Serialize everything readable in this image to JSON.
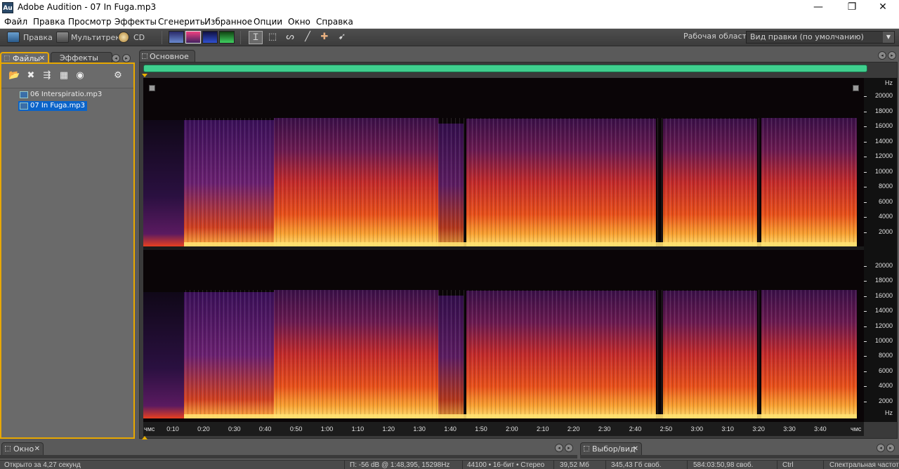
{
  "window": {
    "icon_text": "Au",
    "title": "Adobe Audition - 07 In Fuga.mp3",
    "minimize": "—",
    "maximize": "❐",
    "close": "✕"
  },
  "menu": [
    "Файл",
    "Правка",
    "Просмотр",
    "Эффекты",
    "Сгенерить",
    "Избранное",
    "Опции",
    "Окно",
    "Справка"
  ],
  "toolbar": {
    "edit_label": "Правка",
    "multitrack_label": "Мультитрек",
    "cd_label": "CD",
    "workspace_label": "Рабочая область:",
    "workspace_value": "Вид правки (по умолчанию)",
    "tools": [
      "time-selection-tool",
      "marquee-tool",
      "lasso-tool",
      "brush-tool",
      "spot-healing-tool",
      "scrub-tool"
    ],
    "tool_glyphs": [
      "Ｉ",
      "⬚",
      "ᔕ",
      "╱",
      "✚",
      "➹"
    ]
  },
  "left_panel": {
    "tabs": [
      {
        "label": "Файлы",
        "active": true,
        "close": "✕"
      },
      {
        "label": "Эффекты",
        "active": false
      }
    ],
    "files": [
      {
        "name": "06 Interspiratio.mp3",
        "selected": false
      },
      {
        "name": "07 In Fuga.mp3",
        "selected": true
      }
    ]
  },
  "main_panel": {
    "tab_label": "Основное",
    "hz_label": "Hz",
    "time_unit": "чмс",
    "freq_ticks_top": [
      "20000",
      "18000",
      "16000",
      "14000",
      "12000",
      "10000",
      "8000",
      "6000",
      "4000",
      "2000"
    ],
    "freq_ticks_bottom": [
      "20000",
      "18000",
      "16000",
      "14000",
      "12000",
      "10000",
      "8000",
      "6000",
      "4000",
      "2000"
    ],
    "time_ticks": [
      "0:10",
      "0:20",
      "0:30",
      "0:40",
      "0:50",
      "1:00",
      "1:10",
      "1:20",
      "1:30",
      "1:40",
      "1:50",
      "2:00",
      "2:10",
      "2:20",
      "2:30",
      "2:40",
      "2:50",
      "3:00",
      "3:10",
      "3:20",
      "3:30",
      "3:40"
    ]
  },
  "bottom_panels": {
    "window_tab": "Окно",
    "selection_tab": "Выбор/вид",
    "close": "✕"
  },
  "status": {
    "opened": "Открыто за 4,27 секунд",
    "cursor": "П: -56 dB @ 1:48,395, 15298Hz",
    "format": "44100 • 16-бит • Стерео",
    "size": "39,52 Мб",
    "free": "345,43 Гб своб.",
    "free_time": "584:03:50,98 своб.",
    "key": "Ctrl",
    "view": "Спектральная частота"
  },
  "colors": {
    "accent": "#e8a800",
    "overview": "#3fcf8e",
    "selection": "#0a63c9"
  }
}
